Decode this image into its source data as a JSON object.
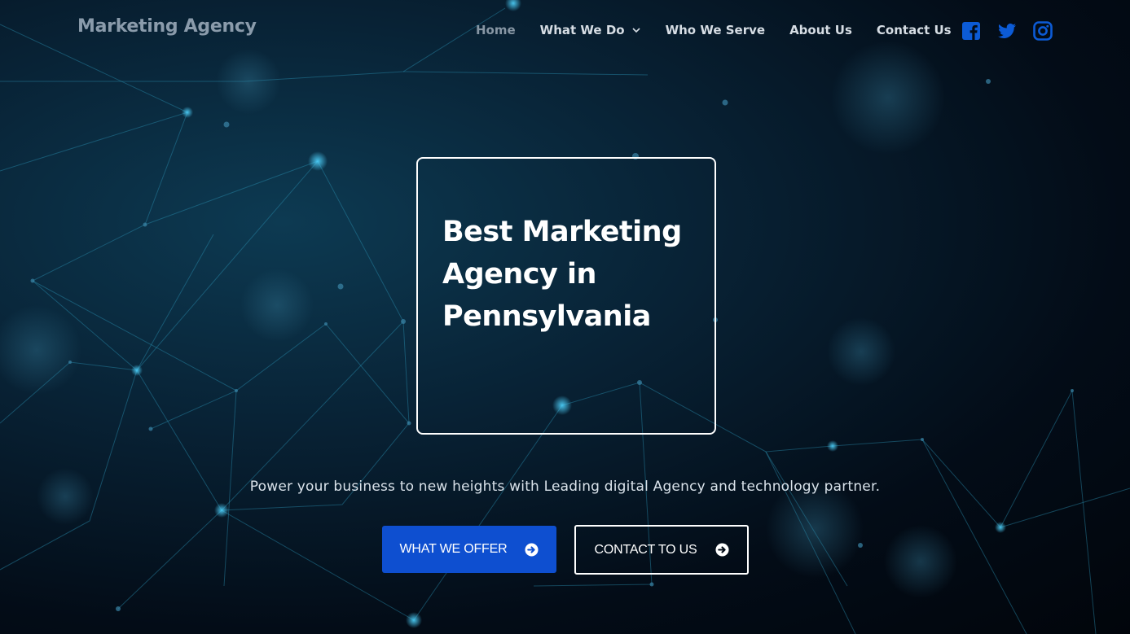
{
  "header": {
    "logo": "Marketing Agency",
    "nav": [
      {
        "label": "Home",
        "active": true
      },
      {
        "label": "What We Do",
        "has_dropdown": true
      },
      {
        "label": "Who We Serve"
      },
      {
        "label": "About Us"
      },
      {
        "label": "Contact Us"
      }
    ],
    "socials": [
      "facebook-icon",
      "twitter-icon",
      "instagram-icon"
    ]
  },
  "hero": {
    "title": "Best Marketing Agency in Pennsylvania",
    "tagline": "Power your business to new heights with Leading digital Agency and technology partner.",
    "buttons": {
      "offer": "WHAT WE OFFER",
      "contact": "CONTACT TO US"
    }
  },
  "colors": {
    "accent_blue": "#0e4fd0",
    "social_blue": "#0c5bd6",
    "background": "#030c17"
  }
}
